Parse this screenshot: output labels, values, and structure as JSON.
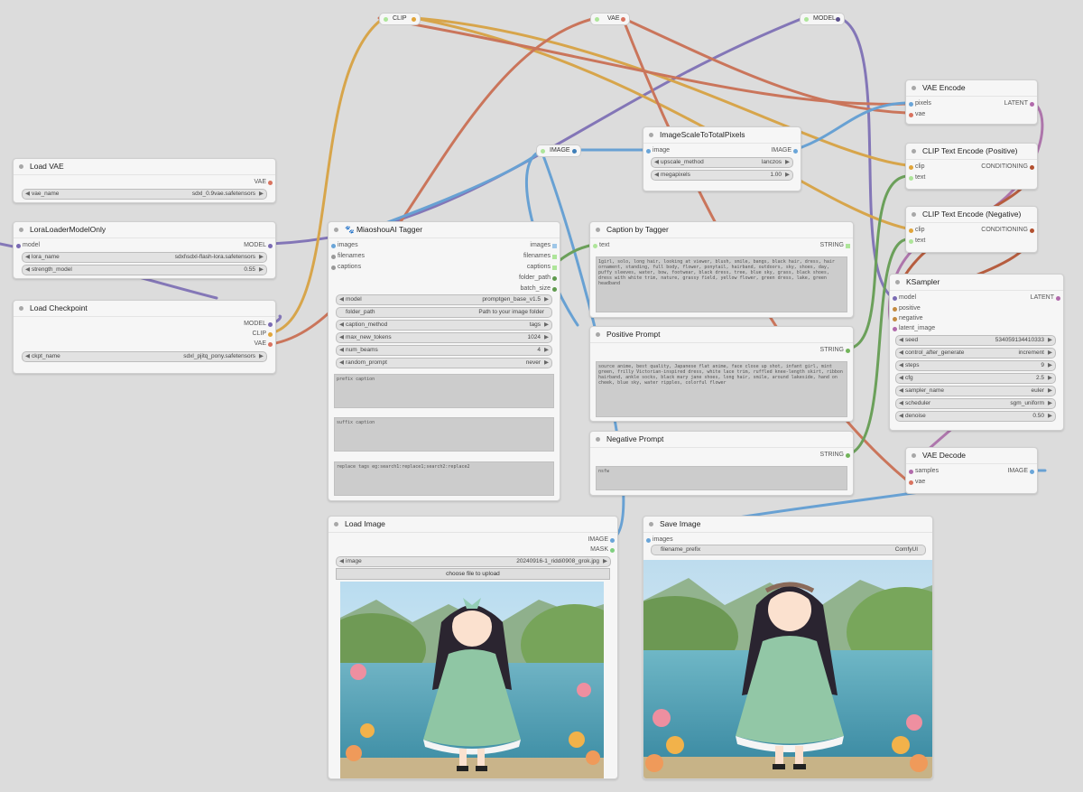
{
  "colors": {
    "clip": "#e1a53a",
    "vae": "#d9735f",
    "model": "#7a6bb3",
    "image": "#6aa5d8",
    "latent": "#b16aab",
    "conditioning": "#c38a3f",
    "string": "#72b45a",
    "mask": "#7fcf7f"
  },
  "reroutes": {
    "clip": "CLIP",
    "vae": "VAE",
    "model": "MODEL",
    "image": "IMAGE"
  },
  "load_vae": {
    "title": "Load VAE",
    "out_vae": "VAE",
    "w_label": "vae_name",
    "w_value": "sdxl_0.9vae.safetensors"
  },
  "lora": {
    "title": "LoraLoaderModelOnly",
    "in_model": "model",
    "out_model": "MODEL",
    "w1_label": "lora_name",
    "w1_value": "sdxl\\sdxl-flash-lora.safetensors",
    "w2_label": "strength_model",
    "w2_value": "0.55"
  },
  "ckpt": {
    "title": "Load Checkpoint",
    "out_model": "MODEL",
    "out_clip": "CLIP",
    "out_vae": "VAE",
    "w_label": "ckpt_name",
    "w_value": "sdxl_pjitq_pony.safetensors"
  },
  "tagger": {
    "title": "🐾 MiaoshouAI Tagger",
    "in_images": "images",
    "in_filenames": "filenames",
    "in_captions": "captions",
    "out_images": "images",
    "out_filenames": "filenames",
    "out_captions": "captions",
    "out_folder": "folder_path",
    "out_batch": "batch_size",
    "w_model_l": "model",
    "w_model_v": "promptgen_base_v1.5",
    "w_folder_l": "folder_path",
    "w_folder_v": "Path to your image folder",
    "w_cm_l": "caption_method",
    "w_cm_v": "tags",
    "w_mnt_l": "max_new_tokens",
    "w_mnt_v": "1024",
    "w_nb_l": "num_beams",
    "w_nb_v": "4",
    "w_rp_l": "random_prompt",
    "w_rp_v": "never",
    "prefix_ph": "prefix caption",
    "suffix_ph": "suffix caption",
    "replace_ph": "replace tags eg:search1:replace1;search2:replace2"
  },
  "scale": {
    "title": "ImageScaleToTotalPixels",
    "in_image": "image",
    "out_image": "IMAGE",
    "w1_label": "upscale_method",
    "w1_value": "lanczos",
    "w2_label": "megapixels",
    "w2_value": "1.00"
  },
  "caption": {
    "title": "Caption by Tagger",
    "in_text": "text",
    "out_string": "STRING",
    "text": "1girl, solo, long hair, looking at viewer, blush, smile, bangs, black hair, dress, hair ornament, standing, full body, flower, ponytail, hairband, outdoors, sky, shoes, day, puffy sleeves, water, bow, footwear, black dress, tree, blue sky, grass, black shoes, dress with white trim, nature, grassy field, yellow flower, green dress, lake, green headband"
  },
  "positive": {
    "title": "Positive Prompt",
    "out_string": "STRING",
    "text": "source anime, best quality, Japanese flat anime, face close up shot, infant girl, mint green, frilly Victorian-inspired dress, white lace trim, ruffled knee-length skirt, ribbon hairband, ankle socks, black mary jane shoes, long hair, smile, around lakeside, hand on cheek, blue sky, water ripples, colorful flower"
  },
  "negative": {
    "title": "Negative Prompt",
    "out_string": "STRING",
    "text": "nsfw"
  },
  "vae_encode": {
    "title": "VAE Encode",
    "in_pixels": "pixels",
    "in_vae": "vae",
    "out_latent": "LATENT"
  },
  "clip_pos": {
    "title": "CLIP Text Encode (Positive)",
    "in_clip": "clip",
    "in_text": "text",
    "out_cond": "CONDITIONING"
  },
  "clip_neg": {
    "title": "CLIP Text Encode (Negative)",
    "in_clip": "clip",
    "in_text": "text",
    "out_cond": "CONDITIONING"
  },
  "ksampler": {
    "title": "KSampler",
    "in_model": "model",
    "in_positive": "positive",
    "in_negative": "negative",
    "in_latent": "latent_image",
    "out_latent": "LATENT",
    "seed_l": "seed",
    "seed_v": "534059134410333",
    "cag_l": "control_after_generate",
    "cag_v": "increment",
    "steps_l": "steps",
    "steps_v": "9",
    "cfg_l": "cfg",
    "cfg_v": "2.5",
    "sampler_l": "sampler_name",
    "sampler_v": "euler",
    "sched_l": "scheduler",
    "sched_v": "sgm_uniform",
    "denoise_l": "denoise",
    "denoise_v": "0.50"
  },
  "vae_decode": {
    "title": "VAE Decode",
    "in_samples": "samples",
    "in_vae": "vae",
    "out_image": "IMAGE"
  },
  "load_image": {
    "title": "Load Image",
    "out_image": "IMAGE",
    "out_mask": "MASK",
    "w_label": "image",
    "w_value": "20240916-1_riddi0908_grok.jpg",
    "upload": "choose file to upload"
  },
  "save_image": {
    "title": "Save Image",
    "in_images": "images",
    "w_label": "filename_prefix",
    "w_value": "ComfyUI"
  }
}
